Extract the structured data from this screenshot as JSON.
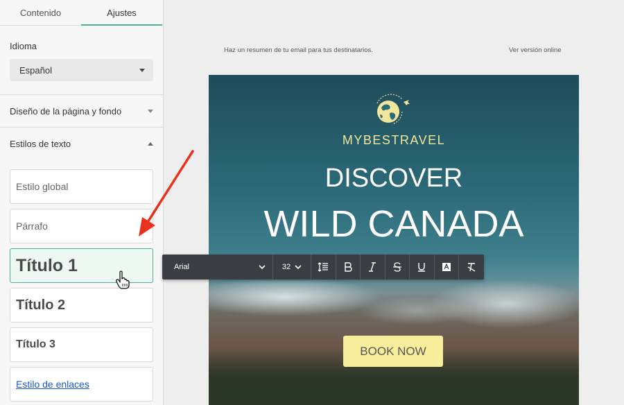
{
  "sidebar": {
    "tabs": [
      {
        "label": "Contenido"
      },
      {
        "label": "Ajustes"
      }
    ],
    "language": {
      "label": "Idioma",
      "value": "Español"
    },
    "page_design": {
      "label": "Diseño de la página y fondo"
    },
    "text_styles": {
      "label": "Estilos de texto",
      "items": [
        {
          "label": "Estilo global"
        },
        {
          "label": "Párrafo"
        },
        {
          "label": "Título 1"
        },
        {
          "label": "Título 2"
        },
        {
          "label": "Título 3"
        },
        {
          "label": "Estilo de enlaces"
        }
      ]
    }
  },
  "email": {
    "preheader": "Haz un resumen de tu email para tus destinatarios.",
    "view_online": "Ver versión online",
    "brand": "MYBESTRAVEL",
    "heading1": "DISCOVER",
    "heading2": "WILD CANADA",
    "cta": "BOOK NOW"
  },
  "toolbar": {
    "font": "Arial",
    "size": "32",
    "icons": [
      "line-height-icon",
      "bold-icon",
      "italic-icon",
      "strikethrough-icon",
      "underline-icon",
      "text-color-icon",
      "clear-format-icon"
    ]
  },
  "colors": {
    "accent": "#4bb38a",
    "brand_yellow": "#f1e69a",
    "cta_yellow": "#f8ed9a",
    "toolbar_bg": "#3b3d44",
    "annotation_red": "#e8321e"
  }
}
